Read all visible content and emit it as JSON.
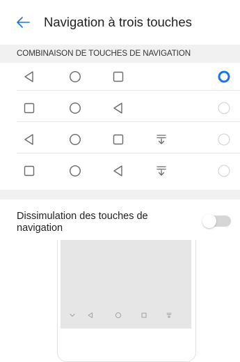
{
  "header": {
    "title": "Navigation à trois touches",
    "back_icon": "arrow-left-icon"
  },
  "section": {
    "title": "COMBINAISON DE TOUCHES DE NAVIGATION"
  },
  "combinations": [
    {
      "keys": [
        "back-triangle-icon",
        "home-circle-icon",
        "recents-square-icon"
      ],
      "selected": true
    },
    {
      "keys": [
        "recents-square-icon",
        "home-circle-icon",
        "back-triangle-icon"
      ],
      "selected": false
    },
    {
      "keys": [
        "back-triangle-icon",
        "home-circle-icon",
        "recents-square-icon",
        "notification-pulldown-icon"
      ],
      "selected": false
    },
    {
      "keys": [
        "recents-square-icon",
        "home-circle-icon",
        "back-triangle-icon",
        "notification-pulldown-icon"
      ],
      "selected": false
    }
  ],
  "hide_keys": {
    "label": "Dissimulation des touches de navigation",
    "enabled": false
  },
  "preview": {
    "keys": [
      "hide-chevron-icon",
      "back-triangle-icon",
      "home-circle-icon",
      "recents-square-icon",
      "notification-pulldown-icon"
    ]
  },
  "colors": {
    "accent": "#1a73e8",
    "icon": "#6b6b6b",
    "radio_off": "#d0d0d0",
    "toggle_off": "#d6d6d6"
  }
}
